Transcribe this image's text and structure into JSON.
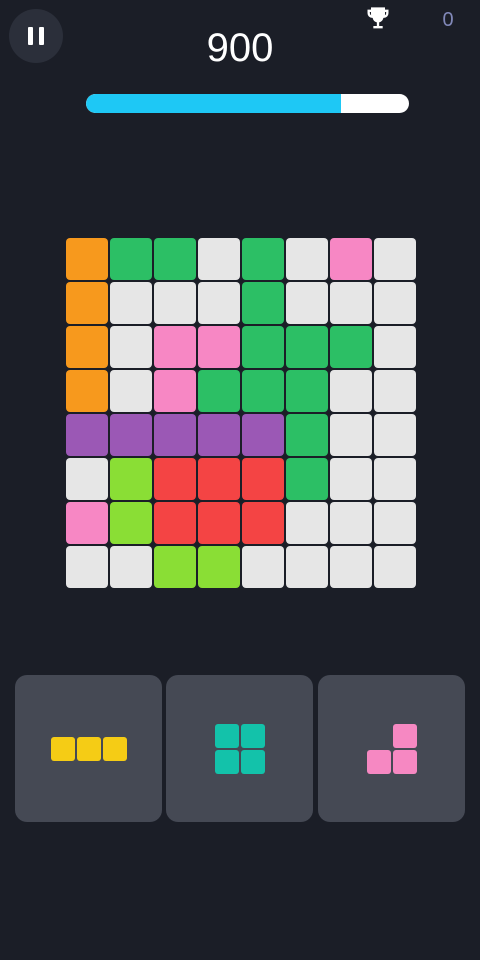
{
  "hud": {
    "pause_icon": "pause-icon",
    "score": "900",
    "best_icon": "trophy-icon",
    "best_score": "0",
    "progress": 0.79
  },
  "colors": {
    "O": "#f7991d",
    "G": "#2cbf65",
    "P": "#f787c4",
    "W": "#e6e6e6",
    "V": "#9b58b5",
    "L": "#8ade35",
    "R": "#f44444",
    "Y": "#f5cc15",
    "T": "#13c2aa",
    "K": "#f688c2",
    "progress_fill": "#1ec8f5",
    "background": "#1b1e27"
  },
  "board": {
    "rows": [
      [
        "O",
        "G",
        "G",
        "W",
        "G",
        "W",
        "P",
        "W"
      ],
      [
        "O",
        "W",
        "W",
        "W",
        "G",
        "W",
        "W",
        "W"
      ],
      [
        "O",
        "W",
        "P",
        "P",
        "G",
        "G",
        "G",
        "W"
      ],
      [
        "O",
        "W",
        "P",
        "G",
        "G",
        "G",
        "W",
        "W"
      ],
      [
        "V",
        "V",
        "V",
        "V",
        "V",
        "G",
        "W",
        "W"
      ],
      [
        "W",
        "L",
        "R",
        "R",
        "R",
        "G",
        "W",
        "W"
      ],
      [
        "P",
        "L",
        "R",
        "R",
        "R",
        "W",
        "W",
        "W"
      ],
      [
        "W",
        "W",
        "L",
        "L",
        "W",
        "W",
        "W",
        "W"
      ]
    ]
  },
  "pieces": [
    {
      "name": "yellow-i3",
      "color": "Y",
      "shape": [
        [
          1,
          1,
          1
        ]
      ]
    },
    {
      "name": "teal-square",
      "color": "T",
      "shape": [
        [
          1,
          1
        ],
        [
          1,
          1
        ]
      ]
    },
    {
      "name": "pink-corner",
      "color": "K",
      "shape": [
        [
          0,
          1
        ],
        [
          1,
          1
        ]
      ]
    }
  ]
}
